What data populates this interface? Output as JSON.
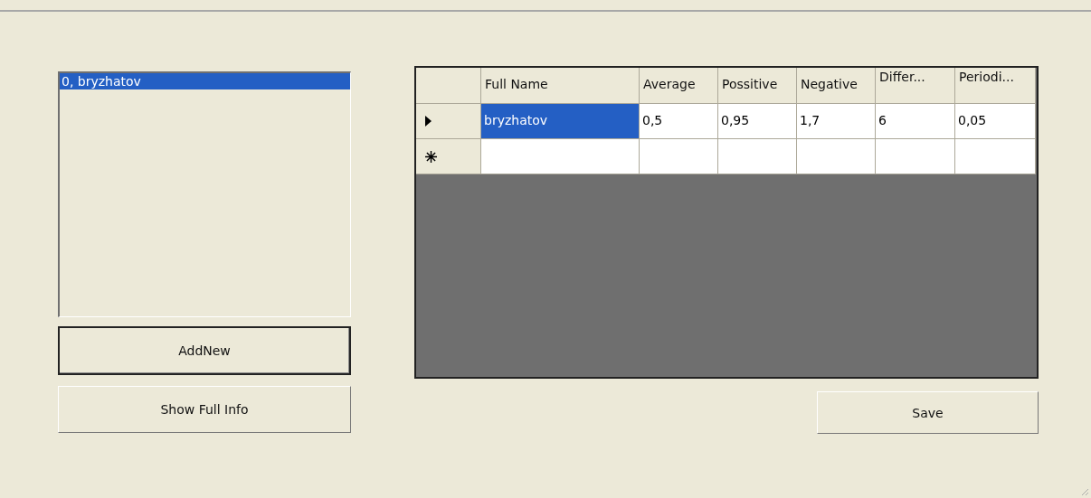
{
  "list_box": {
    "items": [
      {
        "label": "0, bryzhatov",
        "selected": true
      }
    ]
  },
  "buttons": [
    {
      "label": "AddNew",
      "default": true
    },
    {
      "label": "Show Full Info",
      "default": false
    }
  ],
  "grid": {
    "columns": [
      "Full Name",
      "Average",
      "Possitive",
      "Negative",
      "Differ...",
      "Periodi..."
    ],
    "rows": [
      {
        "kind": "current",
        "cells": [
          {
            "text": "bryzhatov",
            "selected": true
          },
          {
            "text": "0,5",
            "selected": false
          },
          {
            "text": "0,95",
            "selected": false
          },
          {
            "text": "1,7",
            "selected": false
          },
          {
            "text": "6",
            "selected": false
          },
          {
            "text": "0,05",
            "selected": false
          }
        ]
      },
      {
        "kind": "new"
      }
    ]
  },
  "save_button": {
    "label": "Save"
  }
}
